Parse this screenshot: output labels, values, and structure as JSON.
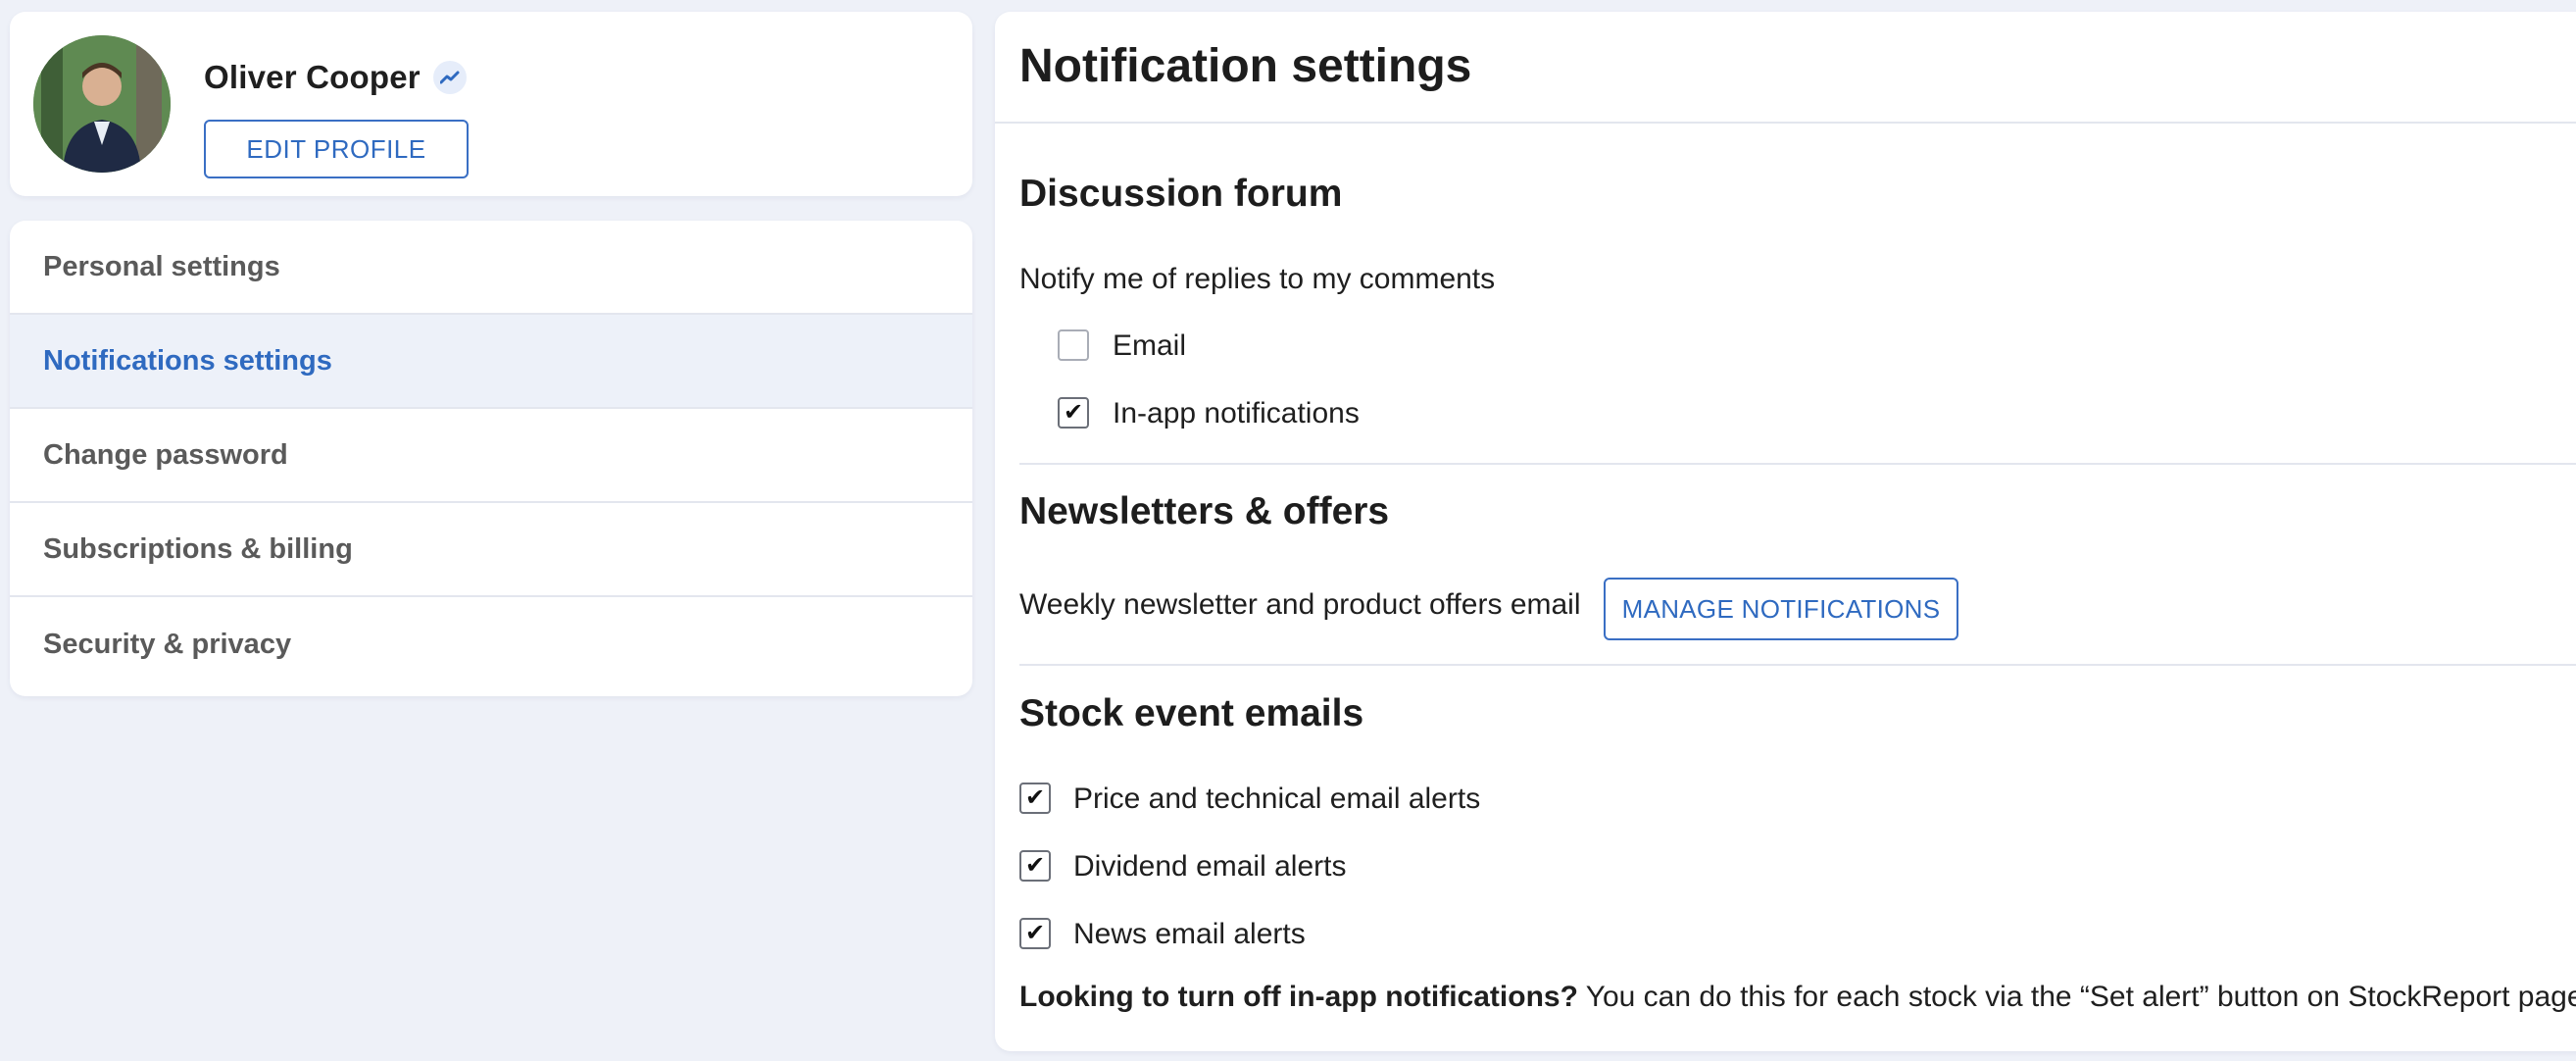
{
  "profile": {
    "name": "Oliver Cooper",
    "edit_label": "EDIT PROFILE"
  },
  "menu": {
    "items": [
      {
        "label": "Personal settings",
        "active": false
      },
      {
        "label": "Notifications settings",
        "active": true
      },
      {
        "label": "Change password",
        "active": false
      },
      {
        "label": "Subscriptions & billing",
        "active": false
      },
      {
        "label": "Security & privacy",
        "active": false
      }
    ]
  },
  "main": {
    "title": "Notification settings",
    "discussion": {
      "title": "Discussion forum",
      "prompt": "Notify me of replies to my comments",
      "options": [
        {
          "label": "Email",
          "checked": false
        },
        {
          "label": "In-app notifications",
          "checked": true
        }
      ]
    },
    "newsletters": {
      "title": "Newsletters & offers",
      "description": "Weekly newsletter and product offers email",
      "button_label": "MANAGE NOTIFICATIONS"
    },
    "stock": {
      "title": "Stock event emails",
      "options": [
        {
          "label": "Price and technical email alerts",
          "checked": true
        },
        {
          "label": "Dividend email alerts",
          "checked": true
        },
        {
          "label": "News email alerts",
          "checked": true
        }
      ]
    },
    "footnote": {
      "bold": "Looking to turn off in-app notifications?",
      "rest": " You can do this for each stock via the “Set alert” button on StockReport pages."
    }
  },
  "colors": {
    "accent": "#2f6ac0",
    "background": "#eef1f8",
    "active_item_bg": "#edf1f9"
  }
}
